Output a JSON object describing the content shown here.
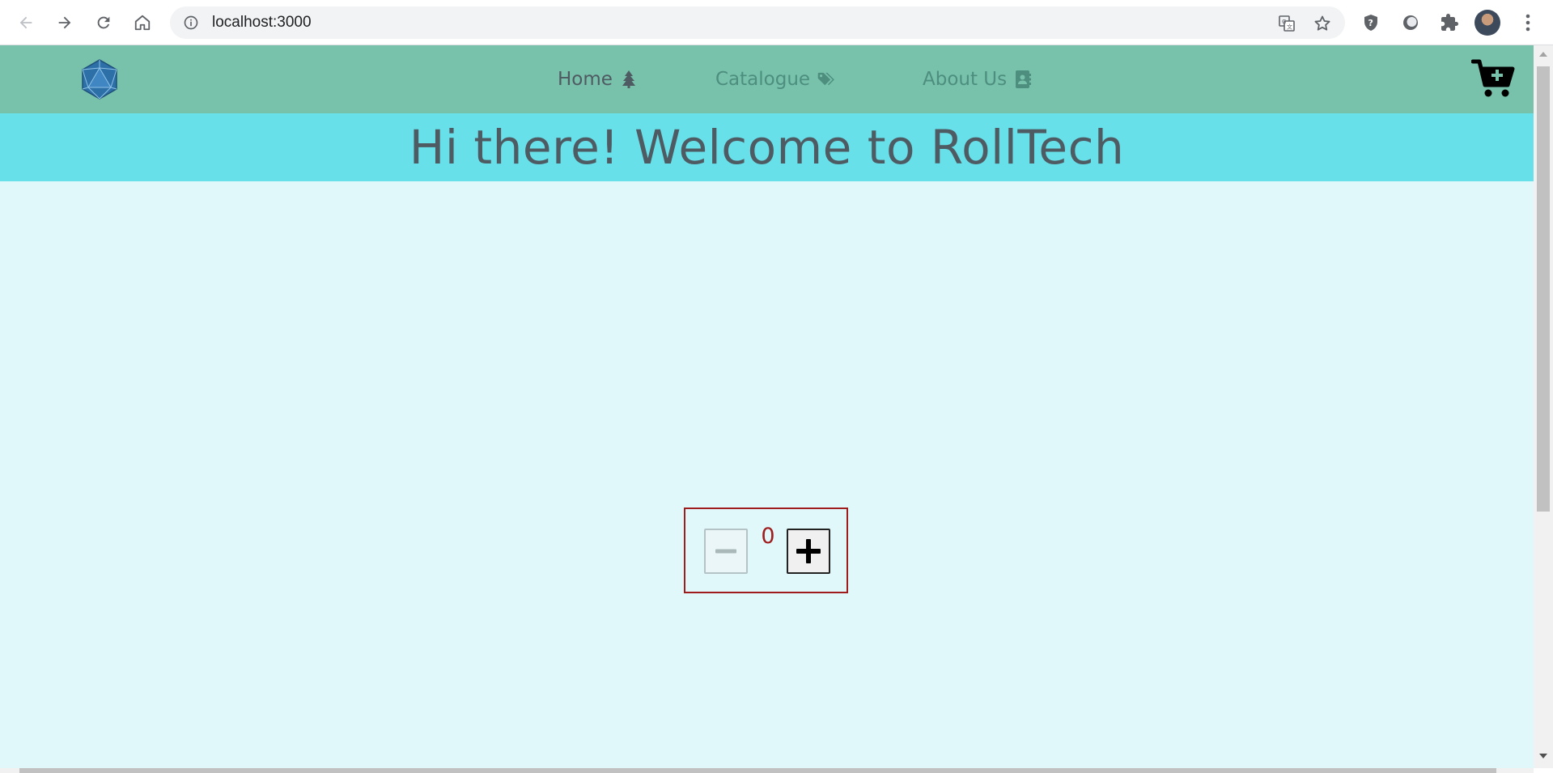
{
  "browser": {
    "url": "localhost:3000",
    "icons": [
      "back-arrow-icon",
      "forward-arrow-icon",
      "reload-icon",
      "home-icon",
      "info-icon",
      "translate-icon",
      "star-icon",
      "shield-extension-icon",
      "circle-extension-icon",
      "puzzle-extension-icon",
      "profile-avatar",
      "kebab-menu-icon"
    ]
  },
  "nav": {
    "logo_icon": "d20-die-logo",
    "links": [
      {
        "label": "Home",
        "icon": "tree-icon",
        "active": true
      },
      {
        "label": "Catalogue",
        "icon": "tags-icon",
        "active": false
      },
      {
        "label": "About Us",
        "icon": "contact-card-icon",
        "active": false
      }
    ],
    "cart_icon": "cart-plus-icon"
  },
  "hero": {
    "title": "Hi there! Welcome to RollTech"
  },
  "counter": {
    "value": "0",
    "minus_icon": "minus-icon",
    "plus_icon": "plus-icon",
    "minus_disabled": true
  },
  "colors": {
    "nav_bg": "#78c2ab",
    "hero_bg": "#68e0ea",
    "page_bg": "#e1f8fb",
    "text_dark": "#4f5b62",
    "text_muted": "#4d8e7e",
    "counter_accent": "#9e1c1c"
  }
}
